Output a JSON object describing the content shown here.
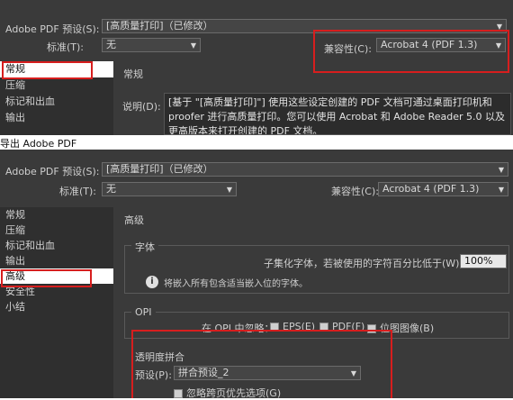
{
  "top": {
    "preset_label": "Adobe PDF 预设(S):",
    "preset_value": "[高质量打印]（已修改）",
    "standard_label": "标准(T):",
    "standard_value": "无",
    "compat_label": "兼容性(C):",
    "compat_value": "Acrobat 4 (PDF 1.3)",
    "sidebar": [
      "常规",
      "压缩",
      "标记和出血",
      "输出"
    ],
    "section_title": "常规",
    "desc_label": "说明(D):",
    "desc_text": "[基于 \"[高质量打印]\"] 使用这些设定创建的 PDF 文档可通过桌面打印机和 proofer 进行高质量打印。您可以使用 Acrobat 和 Adobe Reader 5.0 以及更高版本来打开创建的 PDF 文档。"
  },
  "dialog_title": "导出 Adobe PDF",
  "bottom": {
    "preset_label": "Adobe PDF 预设(S):",
    "preset_value": "[高质量打印]（已修改）",
    "standard_label": "标准(T):",
    "standard_value": "无",
    "compat_label": "兼容性(C):",
    "compat_value": "Acrobat 4 (PDF 1.3)",
    "sidebar": [
      "常规",
      "压缩",
      "标记和出血",
      "输出",
      "高级",
      "安全性",
      "小结"
    ],
    "section_title": "高级",
    "font_group": "字体",
    "font_subset_label": "子集化字体，若被使用的字符百分比低于(W):",
    "font_subset_value": "100%",
    "font_info": "将嵌入所有包含适当嵌入位的字体。",
    "opi_group": "OPI",
    "opi_label": "在 OPI 中忽略：",
    "opi_eps": "EPS(E)",
    "opi_pdf": "PDF(F)",
    "opi_bitmap": "位图图像(B)",
    "flatten_group": "透明度拼合",
    "flatten_preset_label": "预设(P):",
    "flatten_preset_value": "拼合预设_2",
    "flatten_ignore": "忽略跨页优先选项(G)"
  }
}
